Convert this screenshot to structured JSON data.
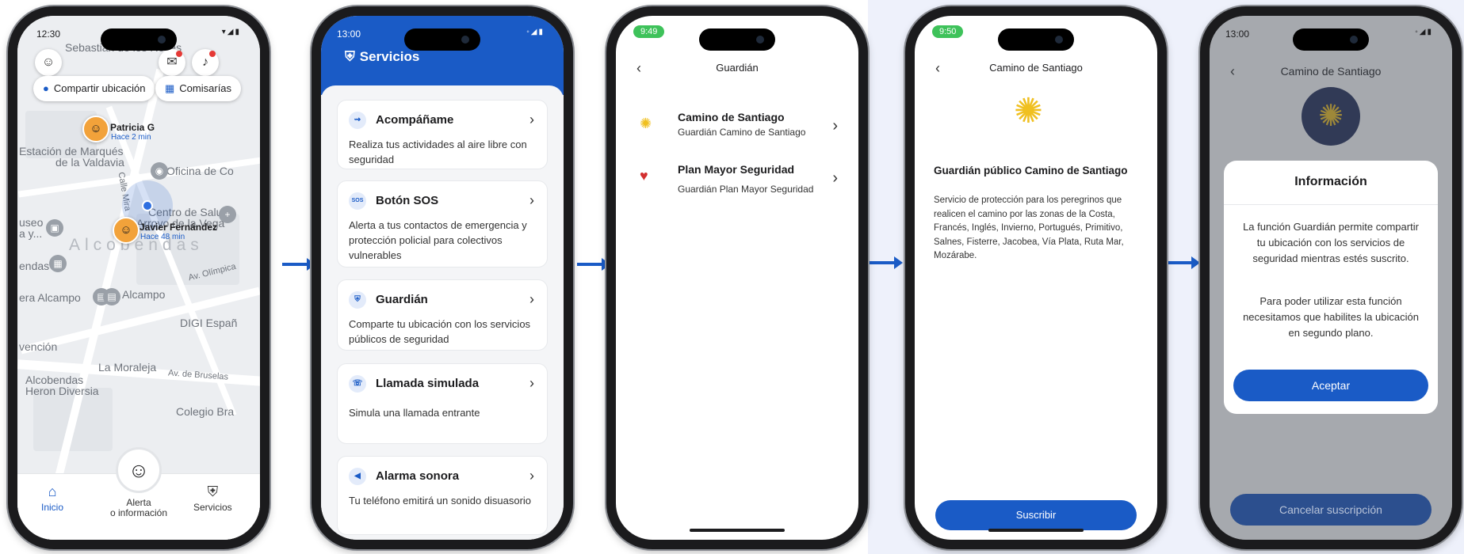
{
  "colors": {
    "primary": "#1a5bc6",
    "status_green": "#3ec25a",
    "alert_red": "#e53935",
    "shell_gold": "#f0c020"
  },
  "screen1": {
    "time": "12:30",
    "map_labels": {
      "sebastian": "Sebastián de los Reyes",
      "estacion": "Estación de Marqués",
      "valdavia": "de la Valdavia",
      "oficina": "Oficina de Co",
      "salud1": "Centro de Salud",
      "salud2": "Arroyo de la Vega",
      "alcobendas_big": "Alcobendas",
      "museo1": "useo",
      "museo2": "a y...",
      "endas": "endas",
      "alcampo": "Alcampo",
      "era_alcampo": "era Alcampo",
      "digi": "DIGI Españ",
      "vencion": "vención",
      "moraleja": "La Moraleja",
      "alcobendas_small": "Alcobendas",
      "heron": "Heron Diversia",
      "colegio": "Colegio Bra",
      "av_olimpica": "Av. Olímpica",
      "av_bruselas": "Av. de Bruselas",
      "calle_mira": "Calle Mira"
    },
    "chips": {
      "share": "Compartir ubicación",
      "police": "Comisarías"
    },
    "pins": [
      {
        "name": "Patricia G",
        "time": "Hace 2 min"
      },
      {
        "name": "Javier Fernández",
        "time": "Hace 48 min"
      }
    ],
    "tabs": {
      "home": "Inicio",
      "alert_line1": "Alerta",
      "alert_line2": "o información",
      "services": "Servicios"
    },
    "icons": [
      "user-icon",
      "chat-icon",
      "bell-icon",
      "location-pin-icon",
      "police-station-icon",
      "home-icon",
      "shield-icon"
    ]
  },
  "screen2": {
    "time": "13:00",
    "title": "Servicios",
    "cards": [
      {
        "title": "Acompáñame",
        "desc": "Realiza tus actividades al aire libre con seguridad",
        "icon": "walk-icon"
      },
      {
        "title": "Botón SOS",
        "desc": "Alerta a tus contactos de emergencia y protección policial para colectivos vulnerables",
        "icon": "sos-icon",
        "icon_text": "SOS"
      },
      {
        "title": "Guardián",
        "desc": "Comparte tu ubicación con los servicios públicos de seguridad",
        "icon": "shield-icon"
      },
      {
        "title": "Llamada simulada",
        "desc": "Simula una llamada entrante",
        "icon": "phone-icon"
      },
      {
        "title": "Alarma sonora",
        "desc": "Tu teléfono emitirá un sonido disuasorio",
        "icon": "megaphone-icon"
      }
    ]
  },
  "screen3": {
    "time": "9:49",
    "title": "Guardián",
    "items": [
      {
        "title": "Camino de Santiago",
        "sub": "Guardián Camino de Santiago",
        "icon": "scallop-shell-icon"
      },
      {
        "title": "Plan Mayor Seguridad",
        "sub": "Guardián Plan Mayor Seguridad",
        "icon": "heart-icon"
      }
    ]
  },
  "screen4": {
    "time": "9:50",
    "title": "Camino de Santiago",
    "heading": "Guardián público Camino de Santiago",
    "body": "Servicio de protección para los peregrinos que realicen el camino por las zonas de la Costa, Francés, Inglés, Invierno, Portugués, Primitivo, Salnes, Fisterre, Jacobea, Vía Plata, Ruta Mar, Mozárabe.",
    "button": "Suscribir"
  },
  "screen5": {
    "time": "13:00",
    "title": "Camino de Santiago",
    "modal_title": "Información",
    "p1": "La función Guardián permite compartir tu ubicación con los servicios de seguridad mientras estés suscrito.",
    "p2": "Para poder utilizar esta función necesitamos que habilites la ubicación en segundo plano.",
    "accept": "Aceptar",
    "cancel": "Cancelar suscripción"
  }
}
